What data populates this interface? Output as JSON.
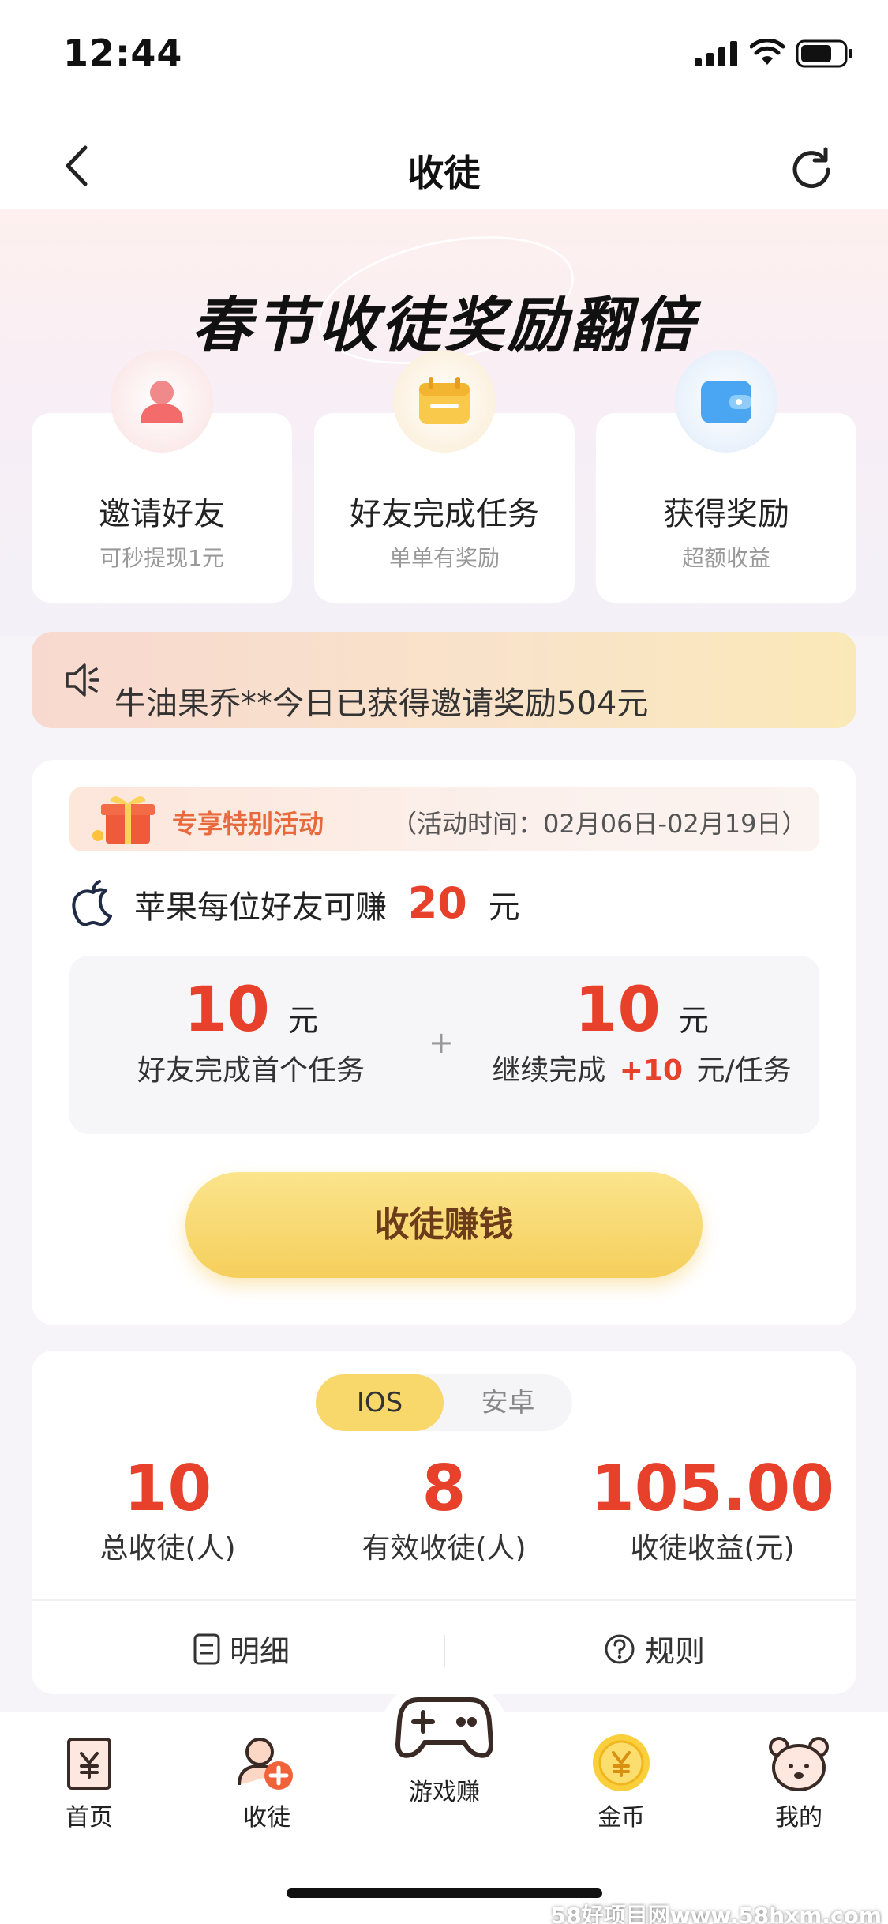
{
  "status_bar": {
    "time": "12:44"
  },
  "nav": {
    "title": "收徒"
  },
  "hero": {
    "title": "春节收徒奖励翻倍",
    "steps": [
      {
        "title": "邀请好友",
        "subtitle": "可秒提现1元"
      },
      {
        "title": "好友完成任务",
        "subtitle": "单单有奖励"
      },
      {
        "title": "获得奖励",
        "subtitle": "超额收益"
      }
    ]
  },
  "notice": {
    "text": "牛油果乔**今日已获得邀请奖励504元"
  },
  "activity": {
    "badge_title": "专享特别活动",
    "badge_time": "（活动时间：02月06日-02月19日）",
    "apple_prefix": "苹果每位好友可赚",
    "apple_amount": "20",
    "apple_unit": "元",
    "left": {
      "amount": "10",
      "unit": "元",
      "desc": "好友完成首个任务"
    },
    "plus": "+",
    "right": {
      "amount": "10",
      "unit": "元",
      "desc_prefix": "继续完成",
      "desc_highlight": "+10",
      "desc_suffix": "元/任务"
    },
    "cta": "收徒赚钱"
  },
  "stats": {
    "tabs": [
      "IOS",
      "安卓"
    ],
    "selected_tab": "IOS",
    "items": [
      {
        "value": "10",
        "label": "总收徒(人)"
      },
      {
        "value": "8",
        "label": "有效收徒(人)"
      },
      {
        "value": "105.00",
        "label": "收徒收益(元)"
      }
    ],
    "detail_link": "明细",
    "rules_link": "规则"
  },
  "tabbar": {
    "items": [
      {
        "label": "首页",
        "icon": "receipt-yen-icon"
      },
      {
        "label": "收徒",
        "icon": "add-user-icon"
      },
      {
        "label": "游戏赚",
        "icon": "gamepad-icon"
      },
      {
        "label": "金币",
        "icon": "gold-coin-icon"
      },
      {
        "label": "我的",
        "icon": "bear-face-icon"
      }
    ]
  },
  "watermark": "58好项目网www.58hxm.com",
  "colors": {
    "accent_red": "#e8412b",
    "cta_yellow": "#f5cf5c",
    "badge_orange": "#e86a3c"
  }
}
